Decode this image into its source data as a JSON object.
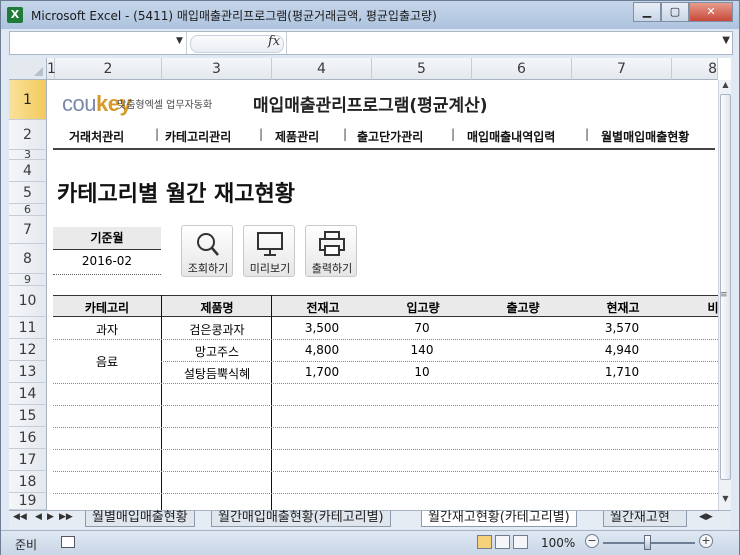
{
  "window": {
    "title": "Microsoft Excel - (5411) 매입매출관리프로그램(평균거래금액, 평균입출고량)",
    "app_icon": "X"
  },
  "formula_bar": {
    "name_box": "",
    "fx": "fx",
    "formula": ""
  },
  "columns": [
    "1",
    "2",
    "3",
    "4",
    "5",
    "6",
    "7",
    "8"
  ],
  "rows": [
    "1",
    "2",
    "3",
    "4",
    "5",
    "6",
    "7",
    "8",
    "9",
    "10",
    "11",
    "12",
    "13",
    "14",
    "15",
    "16",
    "17",
    "18",
    "19"
  ],
  "header": {
    "brand_co": "cou",
    "brand_key": "key",
    "tagline": "맞춤형엑셀 업무자동화",
    "program_title": "매입매출관리프로그램(평균계산)"
  },
  "nav": [
    "거래처관리",
    "카테고리관리",
    "제품관리",
    "출고단가관리",
    "매입매출내역입력",
    "월별매입매출현황"
  ],
  "nav_separator": "|",
  "page_title": "카테고리별 월간 재고현황",
  "base_month": {
    "label": "기준월",
    "value": "2016-02"
  },
  "buttons": {
    "search": "조회하기",
    "preview": "미리보기",
    "print": "출력하기"
  },
  "table": {
    "headers": [
      "카테고리",
      "제품명",
      "전재고",
      "입고량",
      "출고량",
      "현재고",
      "비"
    ],
    "rows": [
      {
        "category": "과자",
        "product": "검은콩과자",
        "prev_stock": "3,500",
        "in_qty": "70",
        "out_qty": "",
        "cur_stock": "3,570"
      },
      {
        "category": "",
        "product": "망고주스",
        "prev_stock": "4,800",
        "in_qty": "140",
        "out_qty": "",
        "cur_stock": "4,940"
      },
      {
        "category": "",
        "product": "설탕듬뿍식혜",
        "prev_stock": "1,700",
        "in_qty": "10",
        "out_qty": "",
        "cur_stock": "1,710"
      }
    ],
    "merged_category": "음료"
  },
  "sheet_tabs": [
    "월별매입매출현황",
    "월간매입매출현황(카테고리별)",
    "월간재고현황(카테고리별)",
    "월간재고현"
  ],
  "active_tab_index": 2,
  "status": {
    "ready": "준비",
    "zoom": "100%",
    "zoom_minus": "−",
    "zoom_plus": "+"
  }
}
